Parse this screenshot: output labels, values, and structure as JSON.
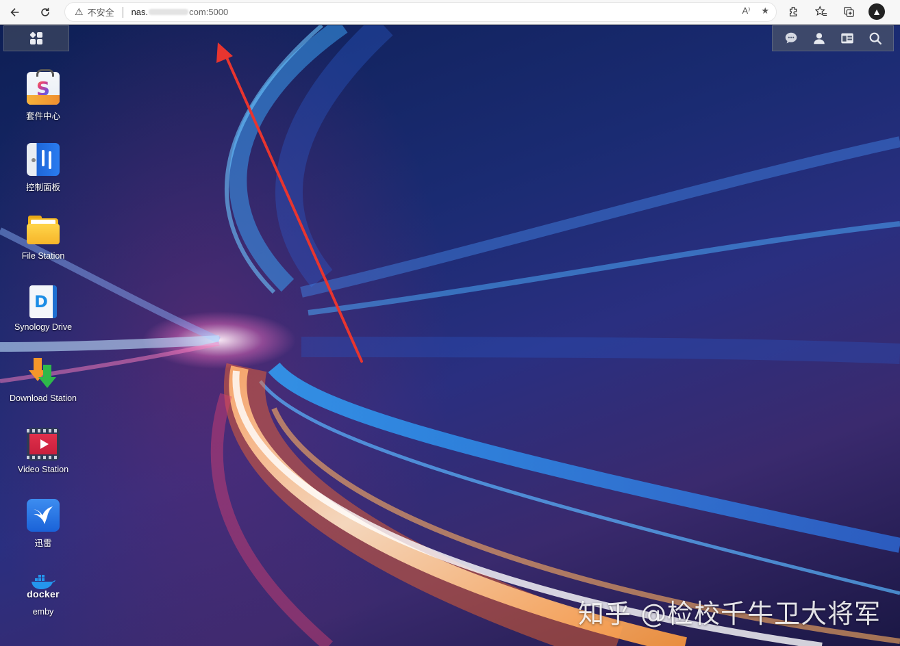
{
  "browser": {
    "security_label": "不安全",
    "url_prefix": "nas.",
    "url_suffix": "com:5000",
    "read_aloud_label": "A⁾",
    "icons": [
      "back-icon",
      "reload-icon",
      "warning-icon",
      "read-aloud-icon",
      "favorite-star-icon",
      "extensions-icon",
      "favorites-icon",
      "collections-icon",
      "profile-icon"
    ]
  },
  "dsm": {
    "tray_icons": [
      "chat-icon",
      "user-icon",
      "widgets-icon",
      "search-icon"
    ],
    "desktop_apps": [
      {
        "label": "套件中心",
        "icon": "package-center-icon"
      },
      {
        "label": "控制面板",
        "icon": "control-panel-icon"
      },
      {
        "label": "File Station",
        "icon": "file-station-icon"
      },
      {
        "label": "Synology Drive",
        "icon": "synology-drive-icon"
      },
      {
        "label": "Download Station",
        "icon": "download-station-icon"
      },
      {
        "label": "Video Station",
        "icon": "video-station-icon"
      },
      {
        "label": "迅雷",
        "icon": "xunlei-icon"
      },
      {
        "label": "emby",
        "icon": "docker-icon",
        "icon_text": "docker"
      }
    ]
  },
  "watermark": "知乎 @检校千牛卫大将军",
  "colors": {
    "accent_arrow": "#e8352f",
    "star": "#1a73e8"
  }
}
